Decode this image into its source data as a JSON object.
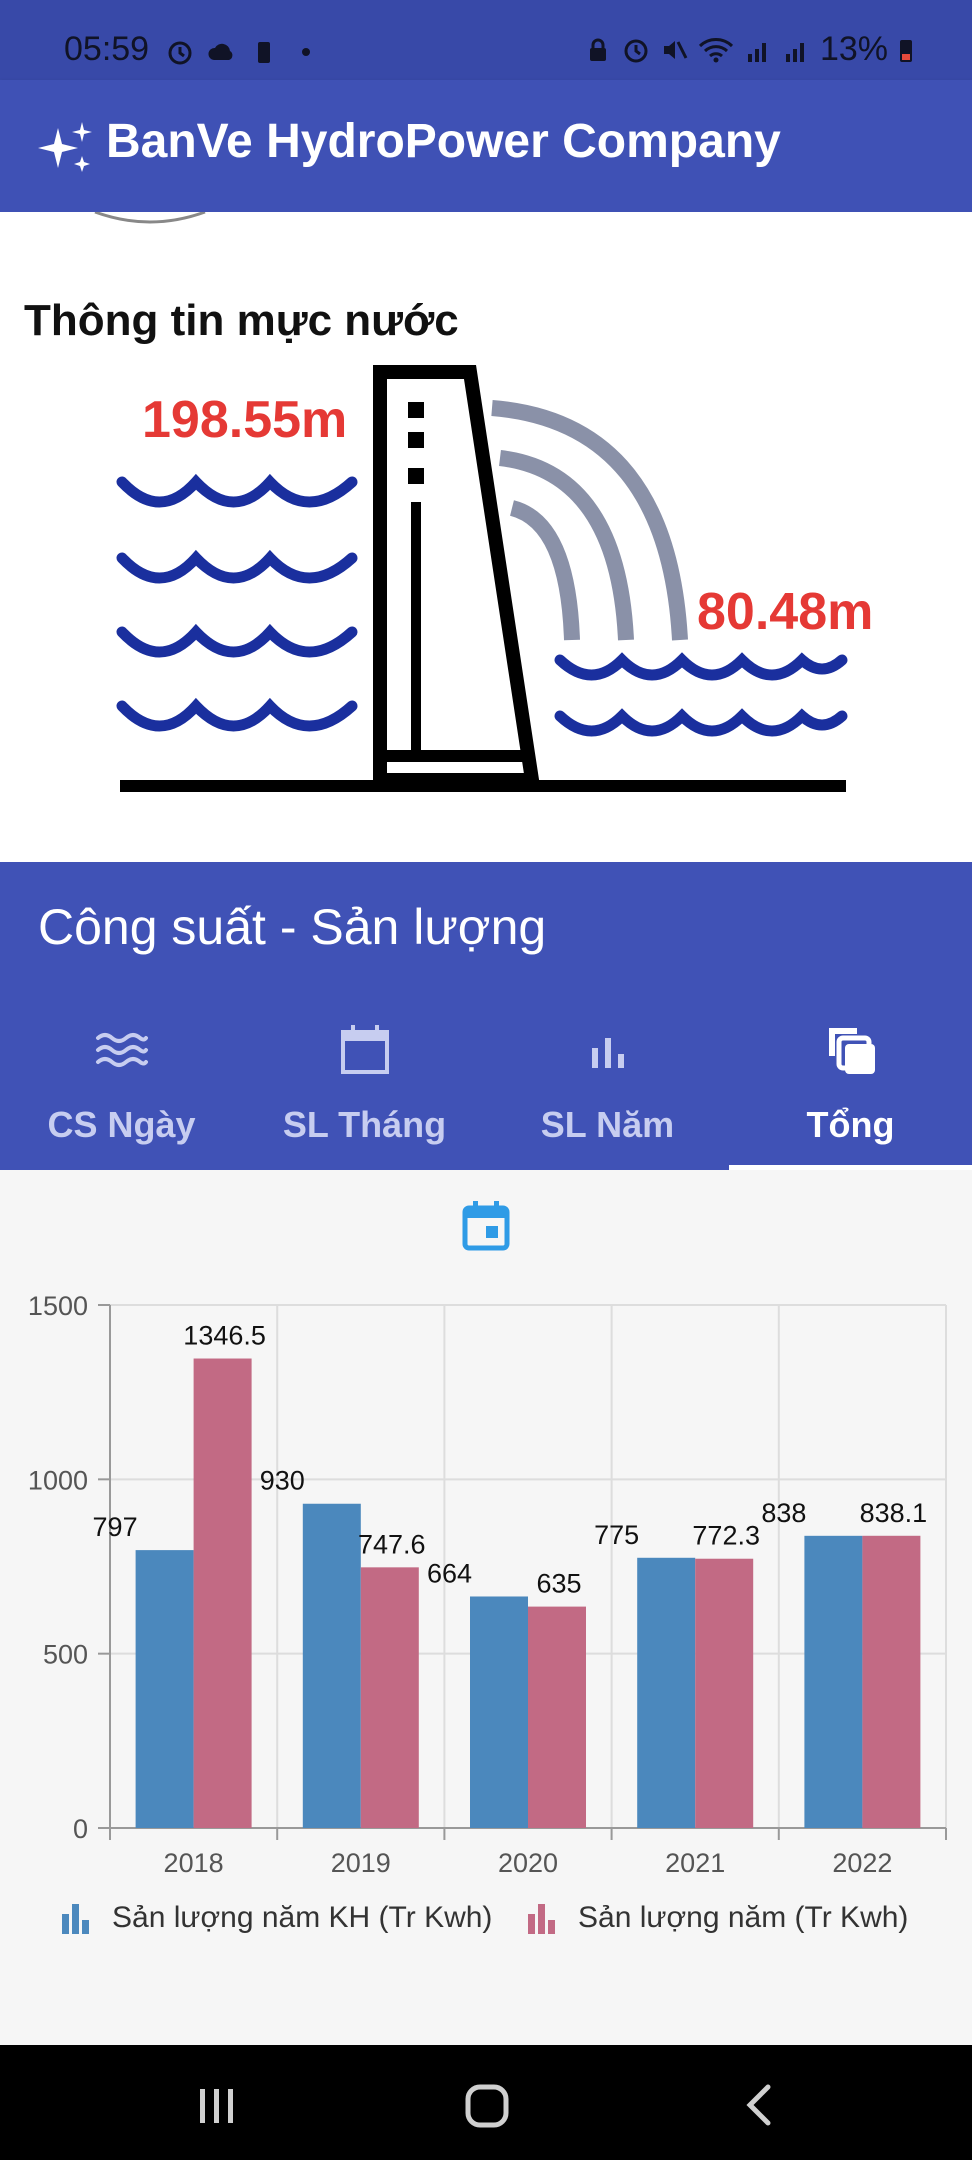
{
  "status_bar": {
    "time": "05:59",
    "battery": "13%"
  },
  "app_bar": {
    "title": "BanVe HydroPower Company"
  },
  "water": {
    "title": "Thông tin mực nước",
    "upstream_level": "198.55m",
    "downstream_level": "80.48m"
  },
  "power": {
    "title": "Công suất - Sản lượng",
    "tabs": [
      {
        "label": "CS Ngày",
        "icon": "waves-icon",
        "active": false
      },
      {
        "label": "SL Tháng",
        "icon": "calendar-icon",
        "active": false
      },
      {
        "label": "SL Năm",
        "icon": "bar-chart-icon",
        "active": false
      },
      {
        "label": "Tổng",
        "icon": "copy-icon",
        "active": true
      }
    ]
  },
  "colors": {
    "primary": "#3f51b5",
    "series_plan": "#4b88bd",
    "series_actual": "#c26a84",
    "level_text": "#e53935"
  },
  "chart_data": {
    "type": "bar",
    "categories": [
      "2018",
      "2019",
      "2020",
      "2021",
      "2022"
    ],
    "series": [
      {
        "name": "Sản lượng năm KH (Tr Kwh)",
        "values": [
          797,
          930,
          664,
          775,
          838
        ],
        "labels": [
          "797",
          "930",
          "664",
          "775",
          "838"
        ]
      },
      {
        "name": "Sản lượng năm (Tr Kwh)",
        "values": [
          1346.5,
          747.6,
          635,
          772.3,
          838.1
        ],
        "labels": [
          "1346.5",
          "747.6",
          "635",
          "772.3",
          "838.1"
        ]
      }
    ],
    "ylim": [
      0,
      1500
    ],
    "yticks": [
      "0",
      "500",
      "1000",
      "1500"
    ],
    "grid": true,
    "legend_position": "bottom"
  }
}
